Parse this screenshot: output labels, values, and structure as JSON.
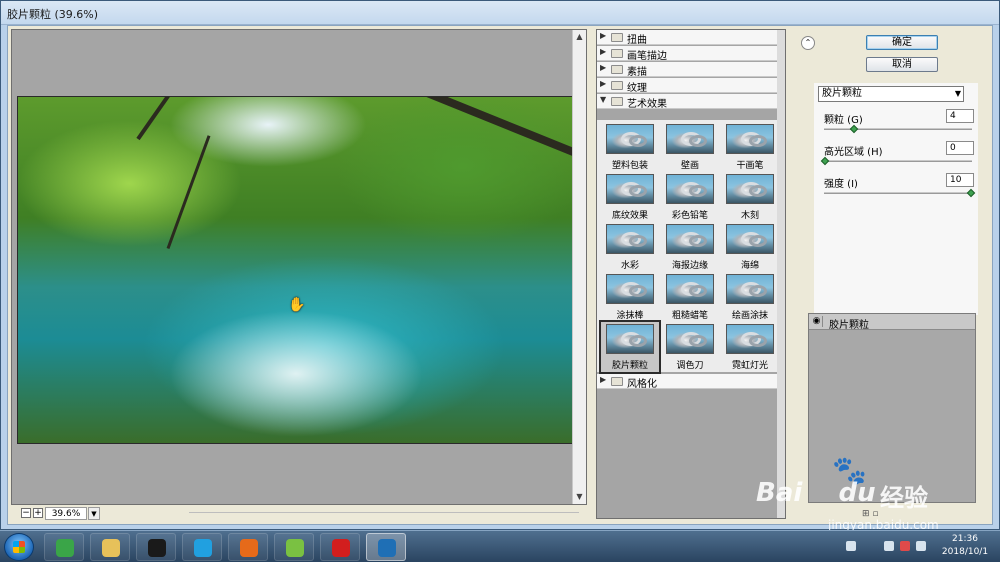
{
  "window": {
    "title": "胶片颗粒 (39.6%)"
  },
  "preview": {
    "zoom": "39.6%",
    "zoom_out": "−",
    "zoom_in": "+"
  },
  "gallery": {
    "categories_top": [
      {
        "label": "扭曲",
        "expanded": false
      },
      {
        "label": "画笔描边",
        "expanded": false
      },
      {
        "label": "素描",
        "expanded": false
      },
      {
        "label": "纹理",
        "expanded": false
      },
      {
        "label": "艺术效果",
        "expanded": true
      }
    ],
    "artistic_filters": [
      "塑料包装",
      "壁画",
      "干画笔",
      "底纹效果",
      "彩色铅笔",
      "木刻",
      "水彩",
      "海报边缘",
      "海绵",
      "涂抹棒",
      "粗糙蜡笔",
      "绘画涂抹",
      "胶片颗粒",
      "调色刀",
      "霓虹灯光"
    ],
    "selected_filter": "胶片颗粒",
    "categories_bottom": [
      {
        "label": "风格化",
        "expanded": false
      }
    ]
  },
  "buttons": {
    "ok": "确定",
    "cancel": "取消"
  },
  "settings": {
    "filter_select": "胶片颗粒",
    "params": [
      {
        "label": "颗粒 (G)",
        "value": "4",
        "fraction": 0.2
      },
      {
        "label": "高光区域 (H)",
        "value": "0",
        "fraction": 0.0
      },
      {
        "label": "强度 (I)",
        "value": "10",
        "fraction": 1.0
      }
    ]
  },
  "layers": {
    "items": [
      {
        "name": "胶片颗粒"
      }
    ]
  },
  "watermark": {
    "brand": "Bai",
    "brand2": "du",
    "cn": "经验",
    "url": "jingyan.baidu.com"
  },
  "taskbar": {
    "clock_time": "21:36",
    "clock_date": "2018/10/1",
    "apps": [
      {
        "name": "browser-360",
        "color": "#3aa548"
      },
      {
        "name": "file-explorer",
        "color": "#e7c15a"
      },
      {
        "name": "qq",
        "color": "#1a1a1a"
      },
      {
        "name": "video-player",
        "color": "#21a0e0"
      },
      {
        "name": "firefox",
        "color": "#e66a1a"
      },
      {
        "name": "media-app",
        "color": "#7ac142"
      },
      {
        "name": "recorder",
        "color": "#d21e1e"
      },
      {
        "name": "photoshop-feather",
        "color": "#1f6fb5"
      }
    ]
  }
}
